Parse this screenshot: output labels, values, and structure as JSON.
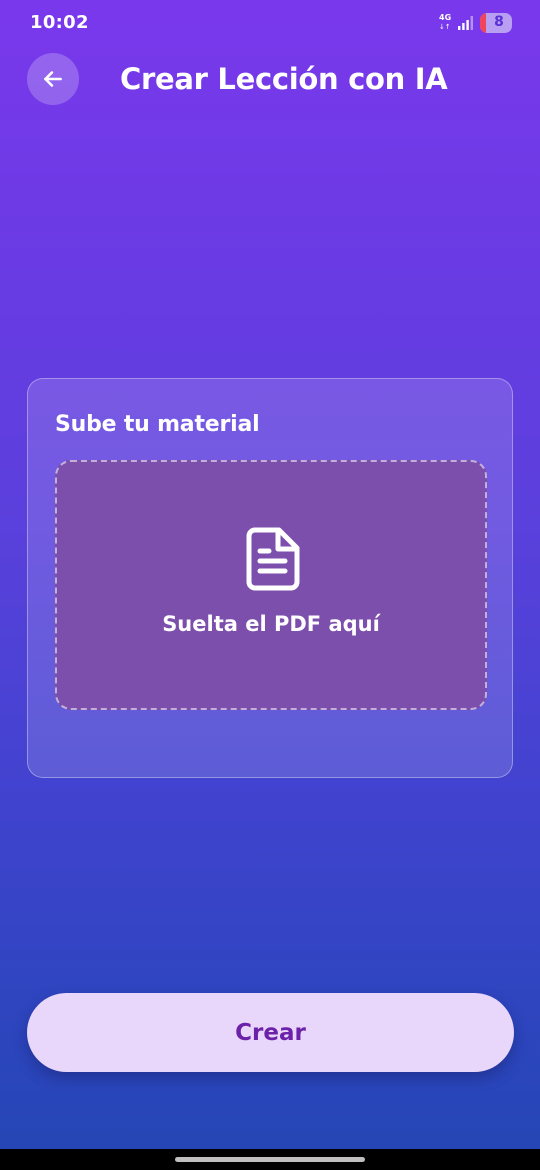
{
  "status_bar": {
    "time": "10:02",
    "network": "4G",
    "network_arrows": "↓↑",
    "battery_level": "8",
    "icons": [
      "signal-icon",
      "battery-icon"
    ]
  },
  "header": {
    "back_icon": "arrow-left-icon",
    "title": "Crear Lección con IA"
  },
  "upload_card": {
    "title": "Sube tu material",
    "dropzone": {
      "icon": "file-text-icon",
      "label": "Suelta el PDF aquí"
    }
  },
  "actions": {
    "create_label": "Crear"
  },
  "colors": {
    "gradient_top": "#7a38ec",
    "gradient_bottom": "#2446b4",
    "dropzone_fill": "#7c4fac",
    "button_fill": "#e8d6fb",
    "button_text": "#6b21a8",
    "battery_low": "#f0435c"
  }
}
